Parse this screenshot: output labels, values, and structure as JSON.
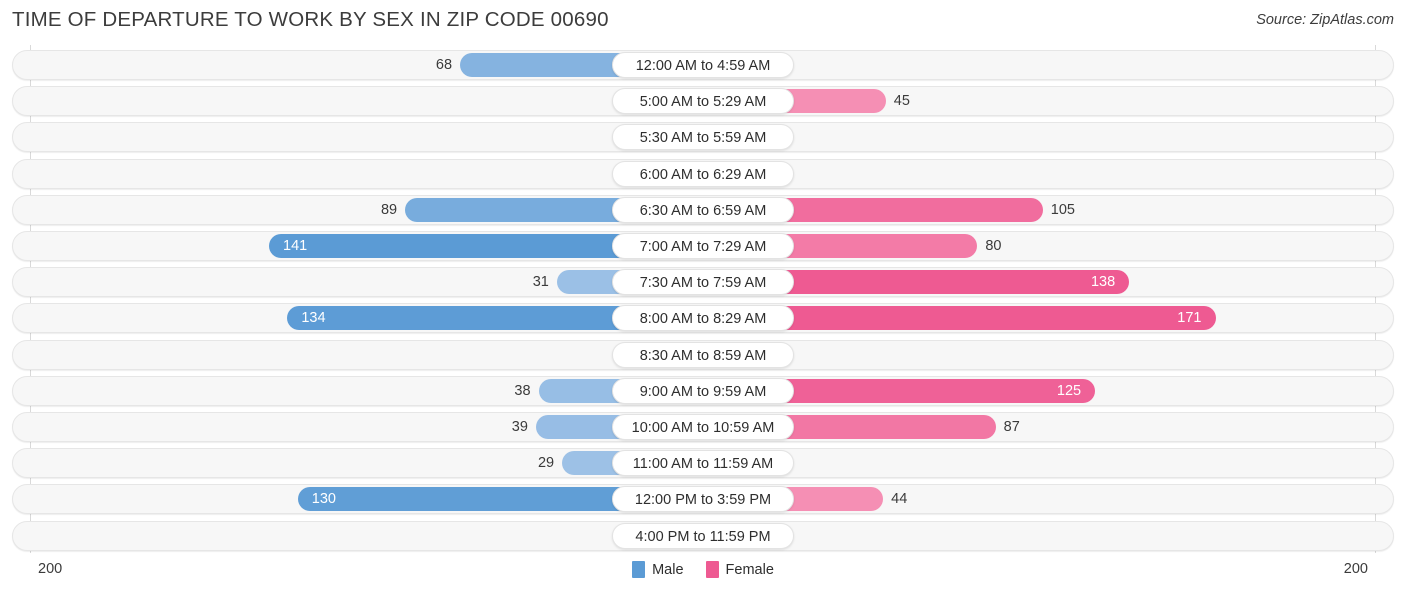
{
  "header": {
    "title": "TIME OF DEPARTURE TO WORK BY SEX IN ZIP CODE 00690",
    "source": "Source: ZipAtlas.com"
  },
  "legend": {
    "male_label": "Male",
    "female_label": "Female",
    "male_color": "#5b9bd5",
    "female_color": "#ee5a92"
  },
  "axis": {
    "left_end": "200",
    "right_end": "200"
  },
  "chart_data": {
    "type": "bar",
    "title": "TIME OF DEPARTURE TO WORK BY SEX IN ZIP CODE 00690",
    "subtitle": "Source: ZipAtlas.com",
    "orientation": "horizontal",
    "style": "diverging-bidirectional",
    "xlabel": "",
    "ylabel": "",
    "xlim": [
      200,
      200
    ],
    "axis_left_max": 200,
    "axis_right_max": 200,
    "grid": false,
    "legend_position": "bottom-center",
    "categories": [
      "12:00 AM to 4:59 AM",
      "5:00 AM to 5:29 AM",
      "5:30 AM to 5:59 AM",
      "6:00 AM to 6:29 AM",
      "6:30 AM to 6:59 AM",
      "7:00 AM to 7:29 AM",
      "7:30 AM to 7:59 AM",
      "8:00 AM to 8:29 AM",
      "8:30 AM to 8:59 AM",
      "9:00 AM to 9:59 AM",
      "10:00 AM to 10:59 AM",
      "11:00 AM to 11:59 AM",
      "12:00 PM to 3:59 PM",
      "4:00 PM to 11:59 PM"
    ],
    "series": [
      {
        "name": "Male",
        "color": "#5b9bd5",
        "side": "left",
        "values": [
          68,
          0,
          0,
          0,
          89,
          141,
          31,
          134,
          0,
          38,
          39,
          29,
          130,
          0
        ]
      },
      {
        "name": "Female",
        "color": "#ee5a92",
        "side": "right",
        "values": [
          0,
          45,
          0,
          0,
          105,
          80,
          138,
          171,
          0,
          125,
          87,
          0,
          44,
          0
        ]
      }
    ]
  }
}
